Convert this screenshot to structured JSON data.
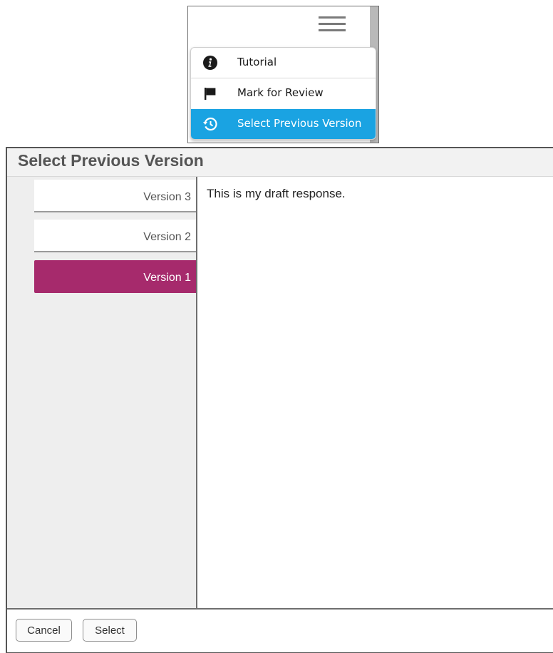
{
  "menu": {
    "items": [
      {
        "label": "Tutorial",
        "icon": "info-icon"
      },
      {
        "label": "Mark for Review",
        "icon": "flag-icon"
      },
      {
        "label": "Select Previous Version",
        "icon": "history-icon"
      }
    ],
    "active_color": "#1aa3e2"
  },
  "dialog": {
    "title": "Select Previous Version",
    "versions": [
      {
        "label": "Version 3"
      },
      {
        "label": "Version 2"
      },
      {
        "label": "Version 1"
      }
    ],
    "selected_version": "Version 1",
    "selected_color": "#a62a6c",
    "content_text": "This is my draft response.",
    "buttons": {
      "cancel": "Cancel",
      "select": "Select"
    }
  }
}
